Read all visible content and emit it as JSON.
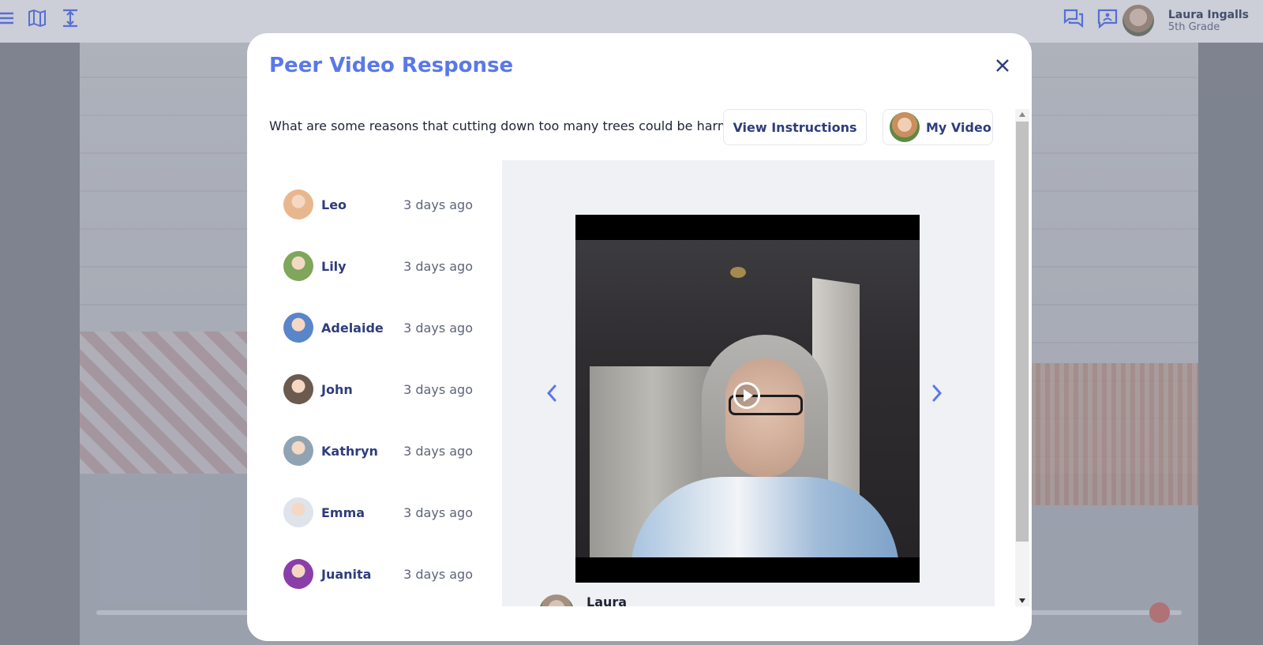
{
  "topbar": {
    "icons": [
      "menu-icon",
      "map-icon",
      "expand-vertical-icon",
      "chat-icon",
      "message-board-icon"
    ],
    "user": {
      "name": "Laura Ingalls",
      "grade": "5th Grade"
    }
  },
  "modal": {
    "title": "Peer Video Response",
    "close_icon": "close-icon",
    "question": "What are some reasons that cutting down too many trees could be harmful?",
    "view_instructions_label": "View Instructions",
    "my_video_label": "My Video",
    "peers": [
      {
        "name": "Leo",
        "time": "3 days ago",
        "avatar_color": "#e8b78e"
      },
      {
        "name": "Lily",
        "time": "3 days ago",
        "avatar_color": "#7fa65a"
      },
      {
        "name": "Adelaide",
        "time": "3 days ago",
        "avatar_color": "#5a86c9"
      },
      {
        "name": "John",
        "time": "3 days ago",
        "avatar_color": "#6b5a4e"
      },
      {
        "name": "Kathryn",
        "time": "3 days ago",
        "avatar_color": "#8fa3b3"
      },
      {
        "name": "Emma",
        "time": "3 days ago",
        "avatar_color": "#dfe3ea"
      },
      {
        "name": "Juanita",
        "time": "3 days ago",
        "avatar_color": "#8a3fa8"
      }
    ],
    "video": {
      "owner_name": "Laura",
      "prev_icon": "chevron-left-icon",
      "next_icon": "chevron-right-icon",
      "play_icon": "play-icon"
    }
  },
  "colors": {
    "accent": "#5a78ea",
    "name_text": "#2e3d7c",
    "muted_text": "#5d6478",
    "panel_bg": "#eff1f5"
  }
}
